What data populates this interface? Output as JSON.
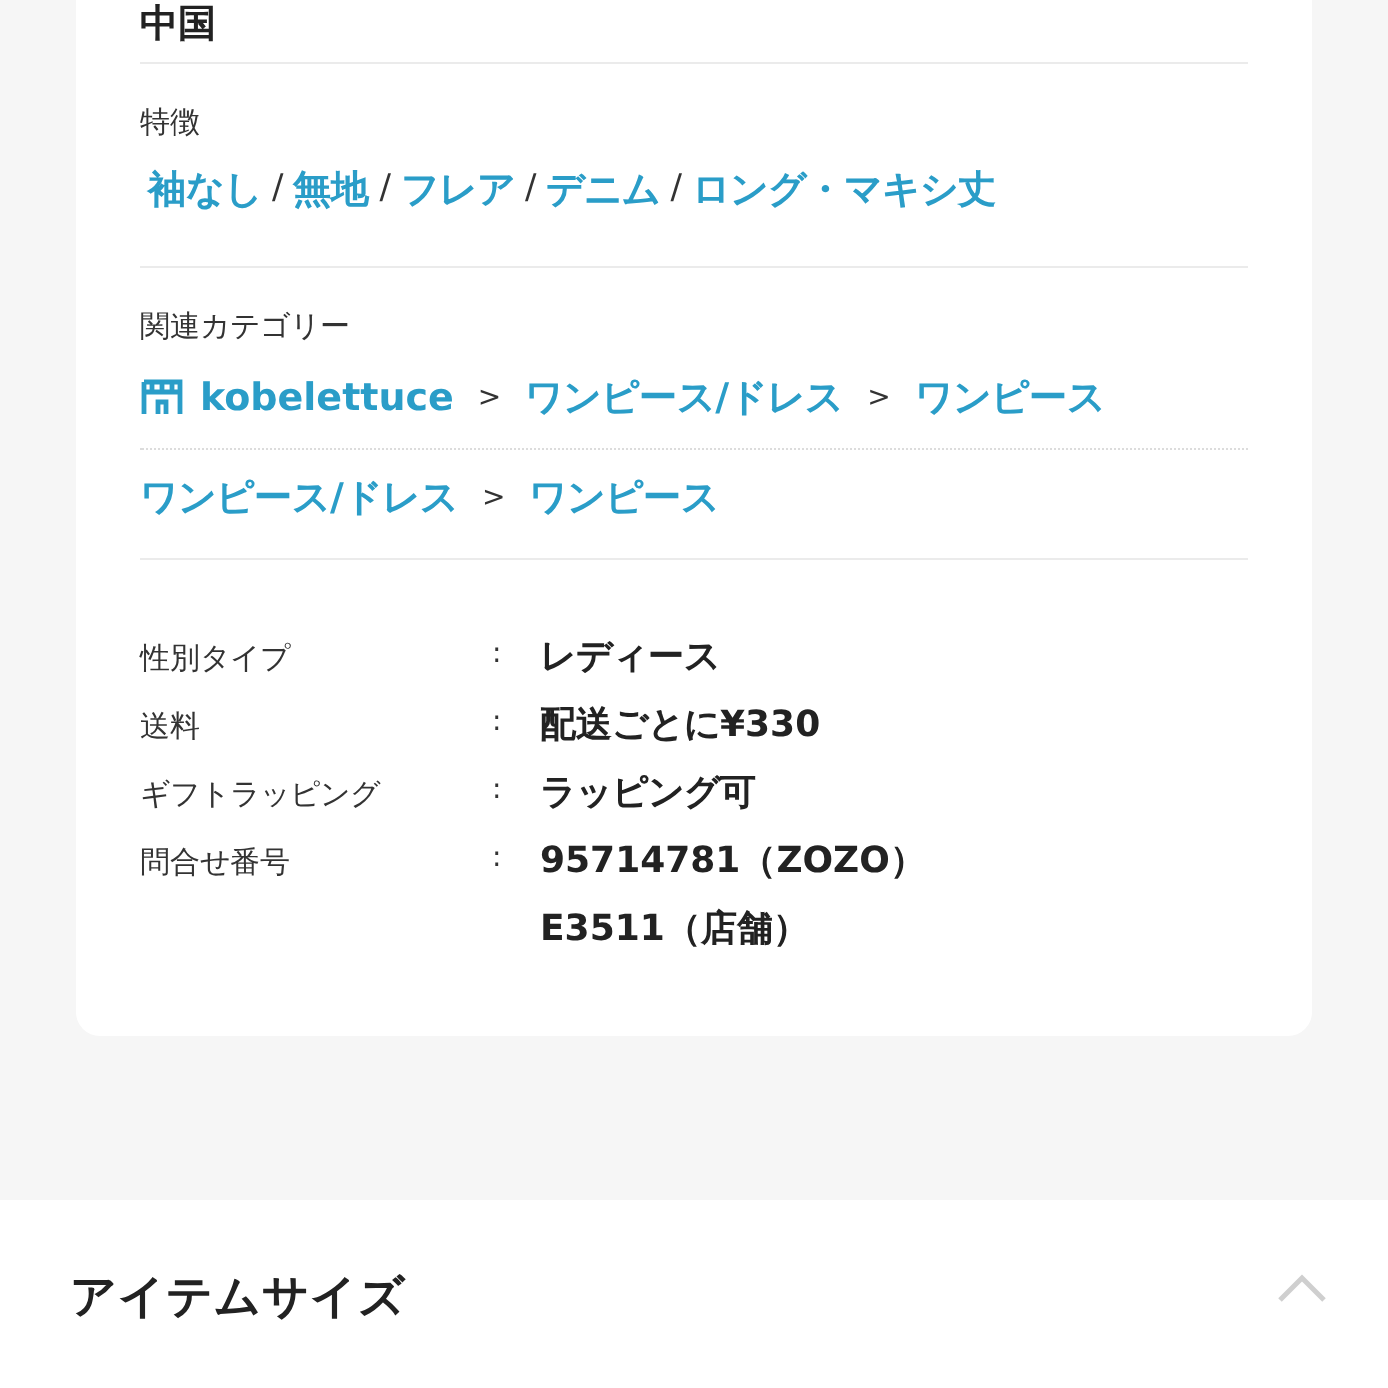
{
  "origin_value": "中国",
  "features": {
    "label": "特徴",
    "separator": "/",
    "tags": [
      "袖なし",
      "無地",
      "フレア",
      "デニム",
      "ロング・マキシ丈"
    ]
  },
  "categories": {
    "label": "関連カテゴリー",
    "separator": ">",
    "rows": [
      {
        "items": [
          {
            "kind": "shop",
            "label": "kobelettuce"
          },
          {
            "kind": "link",
            "label": "ワンピース/ドレス"
          },
          {
            "kind": "link",
            "label": "ワンピース"
          }
        ]
      },
      {
        "items": [
          {
            "kind": "link",
            "label": "ワンピース/ドレス"
          },
          {
            "kind": "link",
            "label": "ワンピース"
          }
        ]
      }
    ]
  },
  "specs": {
    "colon": ":",
    "rows": [
      {
        "label": "性別タイプ",
        "values": [
          "レディース"
        ]
      },
      {
        "label": "送料",
        "values": [
          "配送ごとに¥330"
        ]
      },
      {
        "label": "ギフトラッピング",
        "values": [
          "ラッピング可"
        ]
      },
      {
        "label": "問合せ番号",
        "values": [
          "95714781（ZOZO）",
          "E3511（店舗）"
        ]
      }
    ]
  },
  "item_size": {
    "title": "アイテムサイズ",
    "expanded": true
  }
}
